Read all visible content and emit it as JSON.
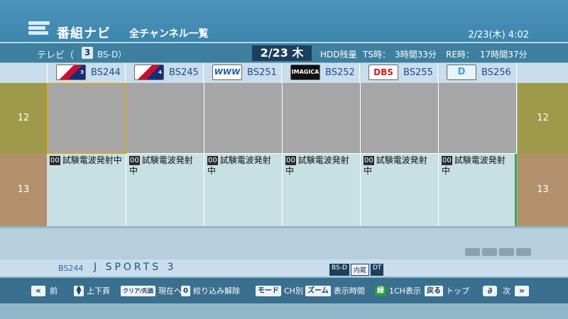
{
  "header": {
    "app_title": "番組ナビ",
    "screen_title": "全チャンネル一覧",
    "clock": "2/23(木) 4:02"
  },
  "info_bar": {
    "tv_label": "テレビ（",
    "channel_number": "3",
    "band": "BS-D）",
    "date": "2/23 木",
    "hdd_label": "HDD残量",
    "ts_label": "TS時：",
    "ts_value": "3時間33分",
    "re_label": "RE時：",
    "re_value": "17時間37分"
  },
  "channels": [
    {
      "name": "BS244",
      "logo_text": "J SPORTS 3"
    },
    {
      "name": "BS245",
      "logo_text": "J SPORTS 4"
    },
    {
      "name": "BS251",
      "logo_text": "WOWOW"
    },
    {
      "name": "BS252",
      "logo_text": "IMAGICA BS"
    },
    {
      "name": "BS255",
      "logo_text": "DBS"
    },
    {
      "name": "BS256",
      "logo_text": "D"
    }
  ],
  "times": [
    "12",
    "13"
  ],
  "program": {
    "minute": "00",
    "title": "試験電波発射中"
  },
  "status_bar": {
    "channel": "BS244",
    "name": "J SPORTS 3",
    "badges": [
      "BS-D",
      "内蔵",
      "DT"
    ]
  },
  "footer": {
    "prev": "前",
    "updown": "上下頁",
    "now_key": "クリア/先頭",
    "now": "現在へ",
    "filter_key": "0",
    "filter": "絞り込み解除",
    "mode_key": "モード",
    "mode": "CH別",
    "zoom_key": "ズーム",
    "zoom": "表示時間",
    "green_key": "緑",
    "one_ch": "1CH表示",
    "back_key": "戻る",
    "top": "トップ",
    "next": "次"
  }
}
